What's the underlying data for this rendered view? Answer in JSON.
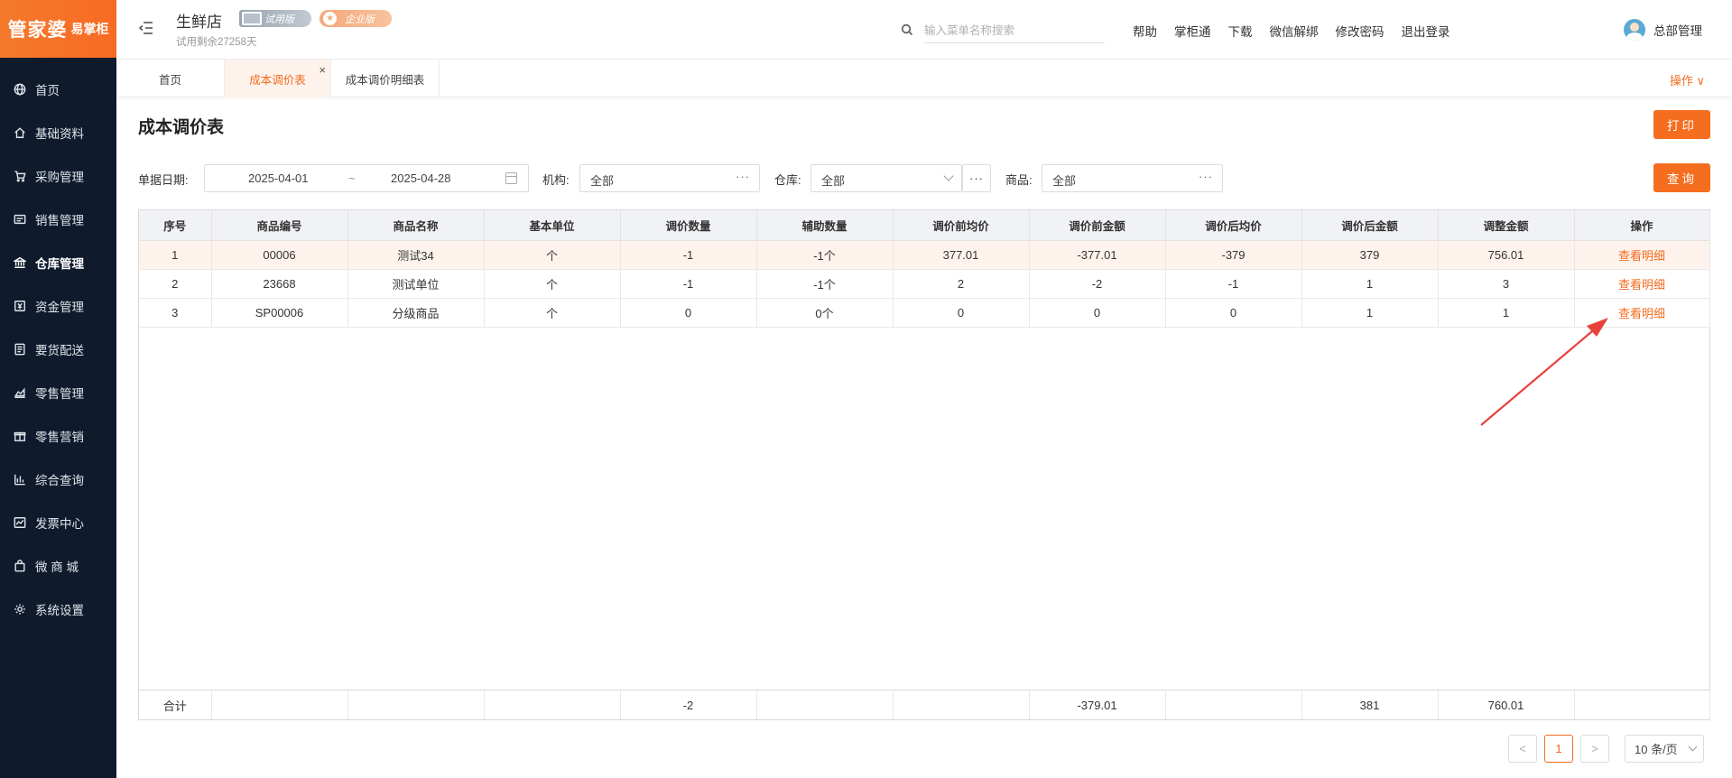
{
  "brand": {
    "logo_main": "管家婆",
    "logo_sub": "易掌柜"
  },
  "sidebar": {
    "items": [
      {
        "label": "首页",
        "icon": "globe-icon"
      },
      {
        "label": "基础资料",
        "icon": "home-icon"
      },
      {
        "label": "采购管理",
        "icon": "cart-icon"
      },
      {
        "label": "销售管理",
        "icon": "sales-icon"
      },
      {
        "label": "仓库管理",
        "icon": "bank-icon"
      },
      {
        "label": "资金管理",
        "icon": "money-icon"
      },
      {
        "label": "要货配送",
        "icon": "list-icon"
      },
      {
        "label": "零售管理",
        "icon": "chart-area-icon"
      },
      {
        "label": "零售营销",
        "icon": "gift-icon"
      },
      {
        "label": "综合查询",
        "icon": "bar-chart-icon"
      },
      {
        "label": "发票中心",
        "icon": "invoice-icon"
      },
      {
        "label": "微 商 城",
        "icon": "bag-icon"
      },
      {
        "label": "系统设置",
        "icon": "gear-icon"
      }
    ],
    "active_index": 4
  },
  "header": {
    "store_name": "生鲜店",
    "badge_trial": "试用版",
    "badge_enterprise": "企业版",
    "trial_days": "试用剩余27258天",
    "search_placeholder": "输入菜单名称搜索",
    "links": [
      "帮助",
      "掌柜通",
      "下载",
      "微信解绑",
      "修改密码",
      "退出登录"
    ],
    "user_name": "总部管理"
  },
  "tabs": [
    {
      "label": "首页"
    },
    {
      "label": "成本调价表",
      "active": true,
      "close": "×"
    },
    {
      "label": "成本调价明细表"
    }
  ],
  "ops_label": "操作 ∨",
  "page": {
    "title": "成本调价表",
    "print_label": "打印",
    "query_label": "查询"
  },
  "filters": {
    "date_label": "单据日期:",
    "date_start": "2025-04-01",
    "date_sep": "~",
    "date_end": "2025-04-28",
    "org_label": "机构:",
    "org_value": "全部",
    "warehouse_label": "仓库:",
    "warehouse_value": "全部",
    "product_label": "商品:",
    "product_value": "全部",
    "more": "···"
  },
  "table": {
    "columns": [
      "序号",
      "商品编号",
      "商品名称",
      "基本单位",
      "调价数量",
      "辅助数量",
      "调价前均价",
      "调价前金额",
      "调价后均价",
      "调价后金额",
      "调整金额",
      "操作"
    ],
    "rows": [
      [
        "1",
        "00006",
        "测试34",
        "个",
        "-1",
        "-1个",
        "377.01",
        "-377.01",
        "-379",
        "379",
        "756.01",
        "查看明细"
      ],
      [
        "2",
        "23668",
        "测试单位",
        "个",
        "-1",
        "-1个",
        "2",
        "-2",
        "-1",
        "1",
        "3",
        "查看明细"
      ],
      [
        "3",
        "SP00006",
        "分级商品",
        "个",
        "0",
        "0个",
        "0",
        "0",
        "0",
        "1",
        "1",
        "查看明细"
      ]
    ],
    "footer": [
      "合计",
      "",
      "",
      "",
      "-2",
      "",
      "",
      "-379.01",
      "",
      "381",
      "760.01",
      ""
    ]
  },
  "pagination": {
    "prev": "<",
    "current": "1",
    "next": ">",
    "page_size": "10 条/页"
  },
  "colors": {
    "accent": "#f56d1e",
    "sidebar_bg": "#0f1b2d",
    "arrow": "#e8413a"
  }
}
